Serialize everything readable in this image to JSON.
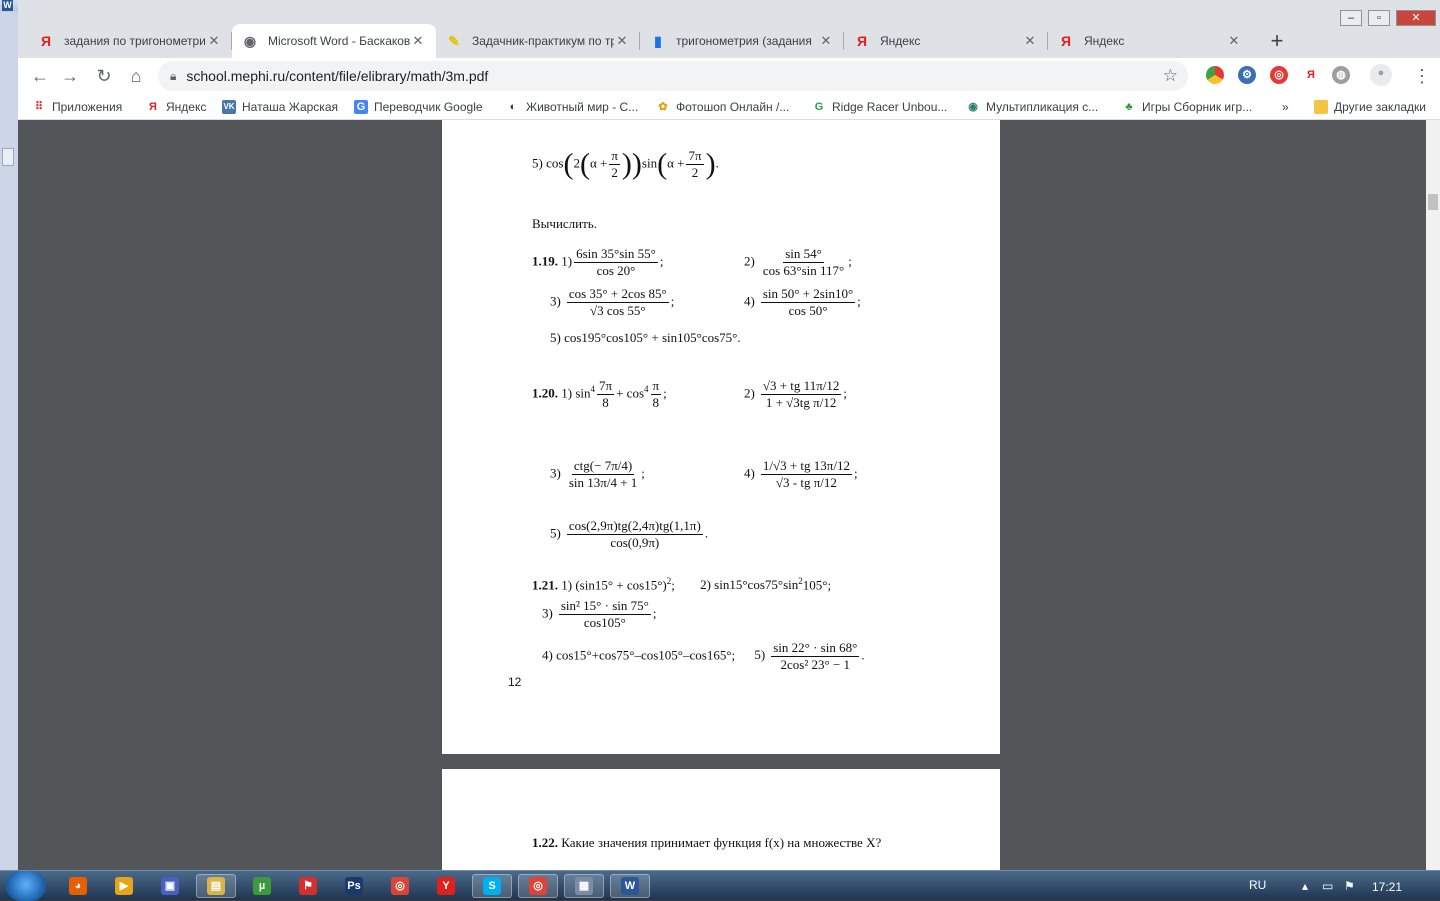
{
  "browser": {
    "tabs": [
      {
        "icon": "yandex-icon",
        "glyph": "Я",
        "title": "задания по тригонометрии",
        "active": false
      },
      {
        "icon": "globe-icon",
        "glyph": "◉",
        "title": "Microsoft Word - Баскаков",
        "active": true
      },
      {
        "icon": "pencil-icon",
        "glyph": "✎",
        "title": "Задачник-практикум по три",
        "active": false
      },
      {
        "icon": "book-icon",
        "glyph": "▮",
        "title": "тригонометрия (задания",
        "active": false
      },
      {
        "icon": "yandex-icon",
        "glyph": "Я",
        "title": "Яндекс",
        "active": false
      },
      {
        "icon": "yandex-icon",
        "glyph": "Я",
        "title": "Яндекс",
        "active": false
      }
    ],
    "new_tab": "+",
    "url": "school.mephi.ru/content/file/elibrary/math/3m.pdf",
    "bookmarks": [
      {
        "label": "Приложения",
        "glyph": "⠿",
        "color": "#d93025"
      },
      {
        "label": "Яндекс",
        "glyph": "Я",
        "color": "#e0201c"
      },
      {
        "label": "Наташа Жарская",
        "glyph": "VK",
        "color": "#4a76a8"
      },
      {
        "label": "Переводчик Google",
        "glyph": "G",
        "color": "#4285f4"
      },
      {
        "label": "Животный мир - С...",
        "glyph": "◐",
        "color": "#333333"
      },
      {
        "label": "Фотошоп Онлайн /...",
        "glyph": "✿",
        "color": "#e6a100"
      },
      {
        "label": "Ridge Racer Unbou...",
        "glyph": "G",
        "color": "#2e9b4e"
      },
      {
        "label": "Мультипликация с...",
        "glyph": "◉",
        "color": "#2a7f6f"
      },
      {
        "label": "Игры Сборник игр...",
        "glyph": "♣",
        "color": "#2e9b2e"
      }
    ],
    "bookmarks_overflow": "»",
    "other_bookmarks": "Другие закладки"
  },
  "pdf": {
    "partial": {
      "num": "5)",
      "text": "cos",
      "c2": "2",
      "alpha": "α +",
      "pi": "π",
      "two": "2",
      "sin": "sin",
      "alpha2": "α +",
      "sevenpi": "7π",
      "two2": "2",
      "end": "."
    },
    "heading": "Вычислить.",
    "p119": {
      "label": "1.19.",
      "i1": {
        "num": "1)",
        "n": "6sin 35°sin 55°",
        "d": "cos 20°",
        "tail": ";"
      },
      "i2": {
        "num": "2)",
        "n": "sin 54°",
        "d": "cos 63°sin 117°",
        "tail": ";"
      },
      "i3": {
        "num": "3)",
        "n": "cos 35° + 2cos 85°",
        "d": "√3 cos 55°",
        "tail": ";"
      },
      "i4": {
        "num": "4)",
        "n": "sin 50° + 2sin10°",
        "d": "cos 50°",
        "tail": ";"
      },
      "i5": "5) cos195°cos105° + sin105°cos75°."
    },
    "p120": {
      "label": "1.20.",
      "i1": {
        "num": "1)",
        "a": "sin",
        "pow": "4",
        "n1": "7π",
        "d1": "8",
        "plus": "+ cos",
        "pow2": "4",
        "n2": "π",
        "d2": "8",
        "tail": ";"
      },
      "i2": {
        "num": "2)",
        "n": "√3 + tg 11π/12",
        "d": "1 + √3tg π/12",
        "tail": ";"
      },
      "i3": {
        "num": "3)",
        "n": "ctg(− 7π/4)",
        "d": "sin 13π/4 + 1",
        "tail": ";"
      },
      "i4": {
        "num": "4)",
        "n": "1/√3 + tg 13π/12",
        "d": "√3 - tg π/12",
        "tail": ";"
      },
      "i5": {
        "num": "5)",
        "n": "cos(2,9π)tg(2,4π)tg(1,1π)",
        "d": "cos(0,9π)",
        "tail": "."
      }
    },
    "p121": {
      "label": "1.21.",
      "i1": "1) (sin15° + cos15°)",
      "i1sup": "2",
      "i1tail": ";",
      "i2": "2) sin15°cos75°sin",
      "i2sup": "2",
      "i2tail": "105°;",
      "i3": {
        "num": "3)",
        "n": "sin² 15° · sin 75°",
        "d": "cos105°",
        "tail": ";"
      },
      "i4": "4) cos15°+cos75°–cos105°–cos165°;",
      "i5": {
        "num": "5)",
        "n": "sin 22° · sin 68°",
        "d": "2cos² 23° − 1",
        "tail": "."
      }
    },
    "page_number": "12",
    "p122": {
      "label": "1.22.",
      "text": "Какие значения принимает функция f(x) на множестве X?"
    }
  },
  "taskbar": {
    "apps": [
      {
        "name": "firefox-taskbar-icon",
        "glyph": "◕",
        "color": "#e66000"
      },
      {
        "name": "media-player-taskbar-icon",
        "glyph": "▶",
        "color": "#e8a317"
      },
      {
        "name": "save-app-taskbar-icon",
        "glyph": "▣",
        "color": "#4a5fc1"
      },
      {
        "name": "explorer-taskbar-icon",
        "glyph": "▤",
        "color": "#d9b44a",
        "open": true
      },
      {
        "name": "utorrent-taskbar-icon",
        "glyph": "µ",
        "color": "#3c9a3c"
      },
      {
        "name": "acrobat-taskbar-icon",
        "glyph": "⚑",
        "color": "#d32f2f"
      },
      {
        "name": "photoshop-taskbar-icon",
        "glyph": "Ps",
        "color": "#1b3a6b"
      },
      {
        "name": "chrome-taskbar-icon",
        "glyph": "◎",
        "color": "#db4437"
      },
      {
        "name": "yandex-browser-taskbar-icon",
        "glyph": "Y",
        "color": "#e0201c"
      },
      {
        "name": "skype-taskbar-icon",
        "glyph": "S",
        "color": "#00aff0",
        "open": true
      },
      {
        "name": "chrome-active-taskbar-icon",
        "glyph": "◎",
        "color": "#db4437",
        "open": true
      },
      {
        "name": "calculator-taskbar-icon",
        "glyph": "▦",
        "color": "#7a8ca6",
        "open": true
      },
      {
        "name": "word-taskbar-icon",
        "glyph": "W",
        "color": "#2b579a",
        "open": true
      }
    ],
    "lang": "RU",
    "clock": "17:21"
  }
}
